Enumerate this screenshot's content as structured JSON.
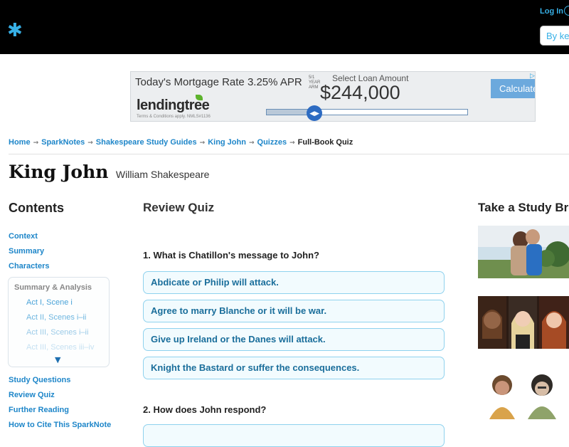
{
  "header": {
    "logo_icon": "asterisk-logo-icon",
    "login_label": "Log In",
    "search_placeholder": "By key"
  },
  "ad": {
    "headline": "Today's Mortgage Rate 3.25% APR",
    "tiny_text": "5/1 YEAR ARM",
    "brand": "lendingtree",
    "terms": "Terms & Conditions apply. NMLS#1136",
    "select_label": "Select Loan Amount",
    "amount": "$244,000",
    "slider_fraction": 0.24,
    "calc_button": "Calculate",
    "choices_icon": "▷"
  },
  "breadcrumb": {
    "items": [
      "Home",
      "SparkNotes",
      "Shakespeare Study Guides",
      "King John",
      "Quizzes"
    ],
    "separator": "→",
    "current": "Full-Book Quiz"
  },
  "page": {
    "title": "King John",
    "author": "William Shakespeare"
  },
  "sidebar": {
    "heading": "Contents",
    "links_top": [
      "Context",
      "Summary",
      "Characters"
    ],
    "summary_analysis": {
      "title": "Summary & Analysis",
      "items": [
        "Act I, Scene i",
        "Act II, Scenes i–ii",
        "Act III, Scenes i–ii",
        "Act III, Scenes iii–iv"
      ],
      "more_icon": "▼"
    },
    "links_bottom": [
      "Study Questions",
      "Review Quiz",
      "Further Reading",
      "How to Cite This SparkNote"
    ]
  },
  "quiz": {
    "heading": "Review Quiz",
    "questions": [
      {
        "text": "1. What is Chatillon's message to John?",
        "answers": [
          "Abdicate or Philip will attack.",
          "Agree to marry Blanche or it will be war.",
          "Give up Ireland or the Danes will attack.",
          "Knight the Bastard or suffer the consequences."
        ]
      },
      {
        "text": "2. How does John respond?",
        "answers": []
      }
    ]
  },
  "study_break": {
    "heading": "Take a Study Break"
  },
  "colors": {
    "header_bg": "#000000",
    "link_blue": "#1e86c9",
    "answer_border": "#8fd2ee",
    "answer_bg": "#f2fbfe",
    "accent_cyan": "#37b0e6"
  }
}
